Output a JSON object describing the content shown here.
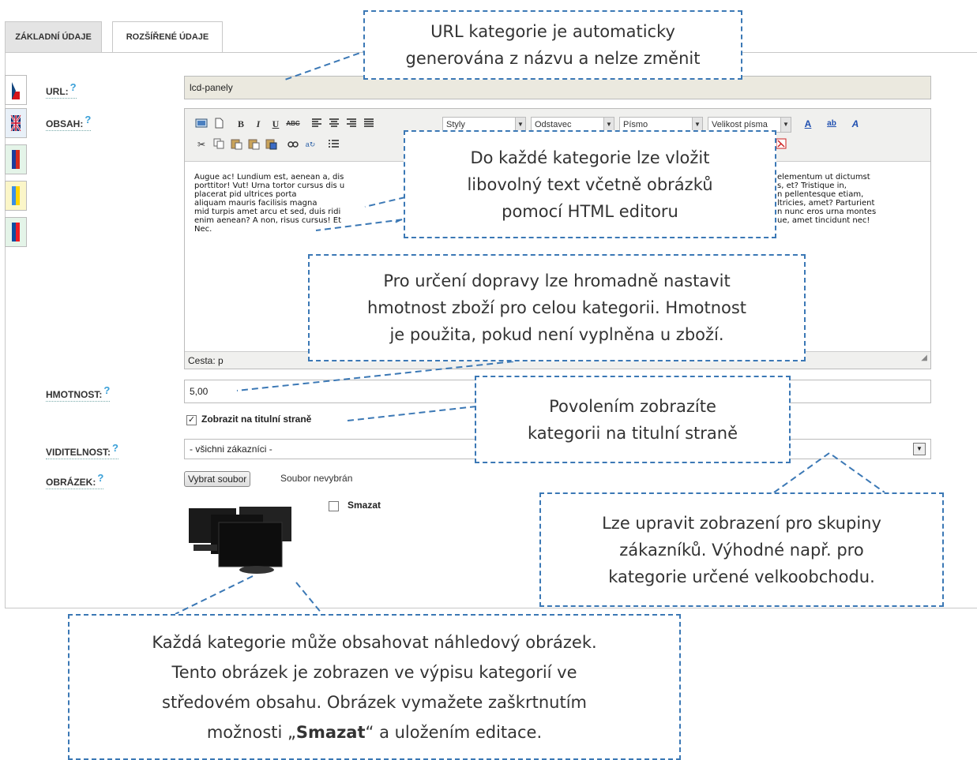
{
  "tabs": {
    "basic": "ZÁKLADNÍ ÚDAJE",
    "extended": "ROZŠÍŘENÉ ÚDAJE"
  },
  "help_mark": "?",
  "fields": {
    "url_label": "URL:",
    "url_value": "lcd-panely",
    "content_label": "OBSAH:",
    "weight_label": "HMOTNOST:",
    "weight_value": "5,00",
    "homepage_label": "Zobrazit na titulní straně",
    "visibility_label": "VIDITELNOST:",
    "visibility_value": "- všichni zákazníci -",
    "image_label": "OBRÁZEK:",
    "file_button": "Vybrat soubor",
    "file_status": "Soubor nevybrán",
    "delete_label": "Smazat"
  },
  "editor": {
    "selects": [
      "Styly",
      "Odstavec",
      "Písmo",
      "Velikost písma"
    ],
    "text_left": "Augue ac! Lundium est, aenean a, dis\nporttitor! Vut! Urna tortor cursus dis u\nplacerat pid ultrices porta\naliquam mauris facilisis magna\nmid turpis amet arcu et sed, duis ridi\nenim aenean? A non, risus cursus! Et\nNec.",
    "text_right": "elementum ut dictumst\ns, et? Tristique in,\nn pellentesque etiam,\nltricies, amet? Parturient\nn nunc eros urna montes\nue, amet tincidunt nec!",
    "status": "Cesta: p"
  },
  "callouts": {
    "url": "URL kategorie je automaticky\ngenerována z názvu a nelze změnit",
    "content": "Do každé kategorie lze vložit\nlibovolný text včetně obrázků\npomocí HTML editoru",
    "weight": "Pro určení dopravy lze hromadně nastavit\nhmotnost zboží pro celou kategorii. Hmotnost\nje použita, pokud není vyplněna u zboží.",
    "homepage": "Povolením zobrazíte\nkategorii na titulní straně",
    "visibility": "Lze upravit zobrazení pro skupiny\nzákazníků. Výhodné např. pro\nkategorie určené velkoobchodu.",
    "image_line1": "Každá kategorie může obsahovat náhledový obrázek.",
    "image_line2": "Tento obrázek je zobrazen ve výpisu kategorií ve",
    "image_line3": "středovém obsahu. Obrázek vymažete zaškrtnutím",
    "image_line4_pre": "možnosti „",
    "image_line4_bold": "Smazat",
    "image_line4_post": "“ a uložením editace."
  },
  "colors": {
    "callout_border": "#3b78b5",
    "help": "#3aa0d8"
  }
}
